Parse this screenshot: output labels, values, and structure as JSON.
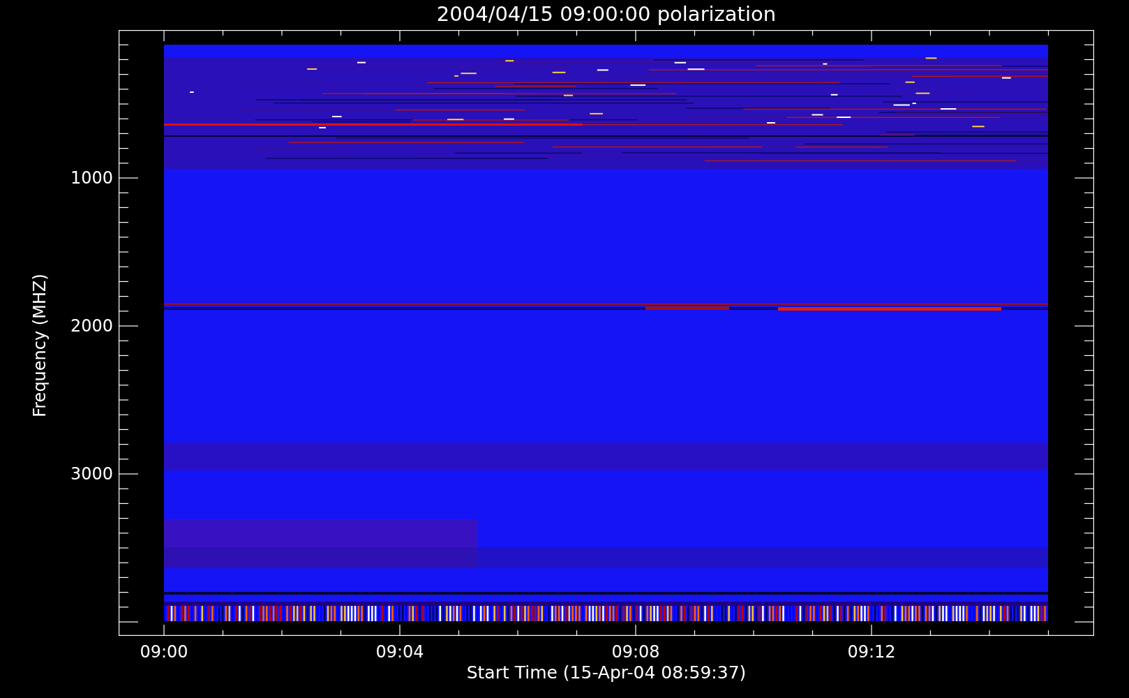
{
  "title": "2004/04/15 09:00:00 polarization",
  "ylabel": "Frequency (MHZ)",
  "xlabel": "Start Time (15-Apr-04 08:59:37)",
  "xticks": [
    "09:00",
    "09:04",
    "09:08",
    "09:12"
  ],
  "yticks": [
    "1000",
    "2000",
    "3000"
  ]
}
